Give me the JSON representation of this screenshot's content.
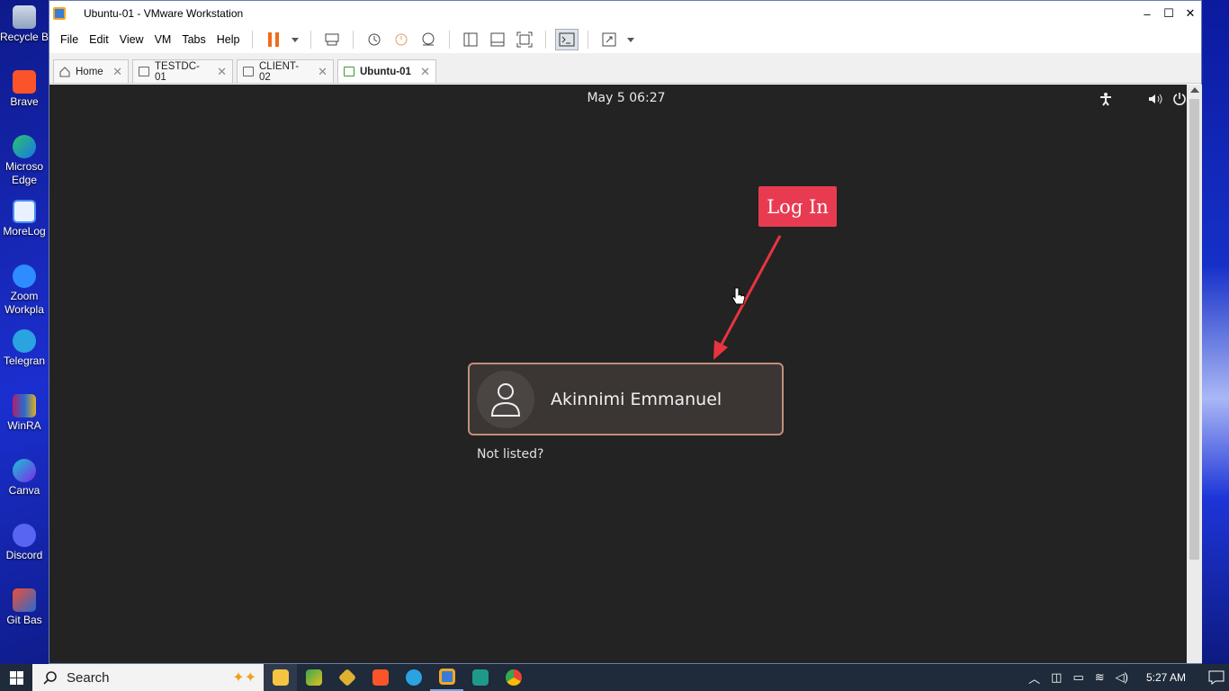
{
  "desktop": {
    "icons": [
      {
        "label": "Recycle B"
      },
      {
        "label": "Brave"
      },
      {
        "label": "Microsoft Edge",
        "line1": "Microso",
        "line2": "Edge"
      },
      {
        "label": "MoreLog"
      },
      {
        "label": "Zoom Workpla",
        "line1": "Zoom",
        "line2": "Workpla"
      },
      {
        "label": "Telegran"
      },
      {
        "label": "WinRA"
      },
      {
        "label": "Canva"
      },
      {
        "label": "Discord"
      },
      {
        "label": "Git Bas"
      }
    ]
  },
  "window": {
    "title": "Ubuntu-01 - VMware Workstation",
    "controls": {
      "minimize": "–",
      "maximize": "☐",
      "close": "✕"
    }
  },
  "menubar": {
    "items": [
      "File",
      "Edit",
      "View",
      "VM",
      "Tabs",
      "Help"
    ]
  },
  "tabs": [
    {
      "label": "Home",
      "active": false
    },
    {
      "label": "TESTDC-01",
      "active": false
    },
    {
      "label": "CLIENT-02",
      "active": false
    },
    {
      "label": "Ubuntu-01",
      "active": true
    }
  ],
  "guest": {
    "clock": "May 5  06:27",
    "annotation": "Log In",
    "user_name": "Akinnimi Emmanuel",
    "not_listed": "Not listed?"
  },
  "taskbar": {
    "search_label": "Search",
    "time": "5:27 AM"
  },
  "colors": {
    "guest_bg": "#232323",
    "annotation_bg": "#e83b52",
    "card_border": "#c28f7b",
    "pause_orange": "#f26a1b"
  }
}
